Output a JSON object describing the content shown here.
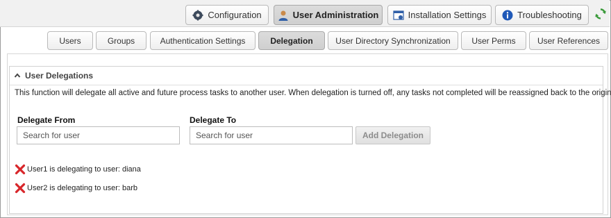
{
  "top_tabs": [
    {
      "label": "Configuration",
      "icon": "gear-icon"
    },
    {
      "label": "User Administration",
      "icon": "user-icon",
      "active": true
    },
    {
      "label": "Installation Settings",
      "icon": "settings-window-icon"
    },
    {
      "label": "Troubleshooting",
      "icon": "info-icon"
    }
  ],
  "sub_tabs": [
    {
      "label": "Users"
    },
    {
      "label": "Groups"
    },
    {
      "label": "Authentication Settings"
    },
    {
      "label": "Delegation",
      "active": true
    },
    {
      "label": "User Directory Synchronization"
    },
    {
      "label": "User Perms"
    },
    {
      "label": "User References"
    }
  ],
  "panel": {
    "title": "User Delegations",
    "description": "This function will delegate all active and future process tasks to another user. When delegation is turned off, any tasks not completed will be reassigned back to the original user."
  },
  "form": {
    "delegate_from_label": "Delegate From",
    "delegate_from_placeholder": "Search for user",
    "delegate_to_label": "Delegate To",
    "delegate_to_placeholder": "Search for user",
    "add_button": "Add Delegation"
  },
  "delegations": [
    {
      "text": "User1 is delegating to user: diana"
    },
    {
      "text": "User2 is delegating to user: barb"
    }
  ],
  "colors": {
    "active_tab_bg": "#d4d4d4",
    "remove_icon": "#d8262a",
    "refresh_icon": "#3a9a3a"
  }
}
